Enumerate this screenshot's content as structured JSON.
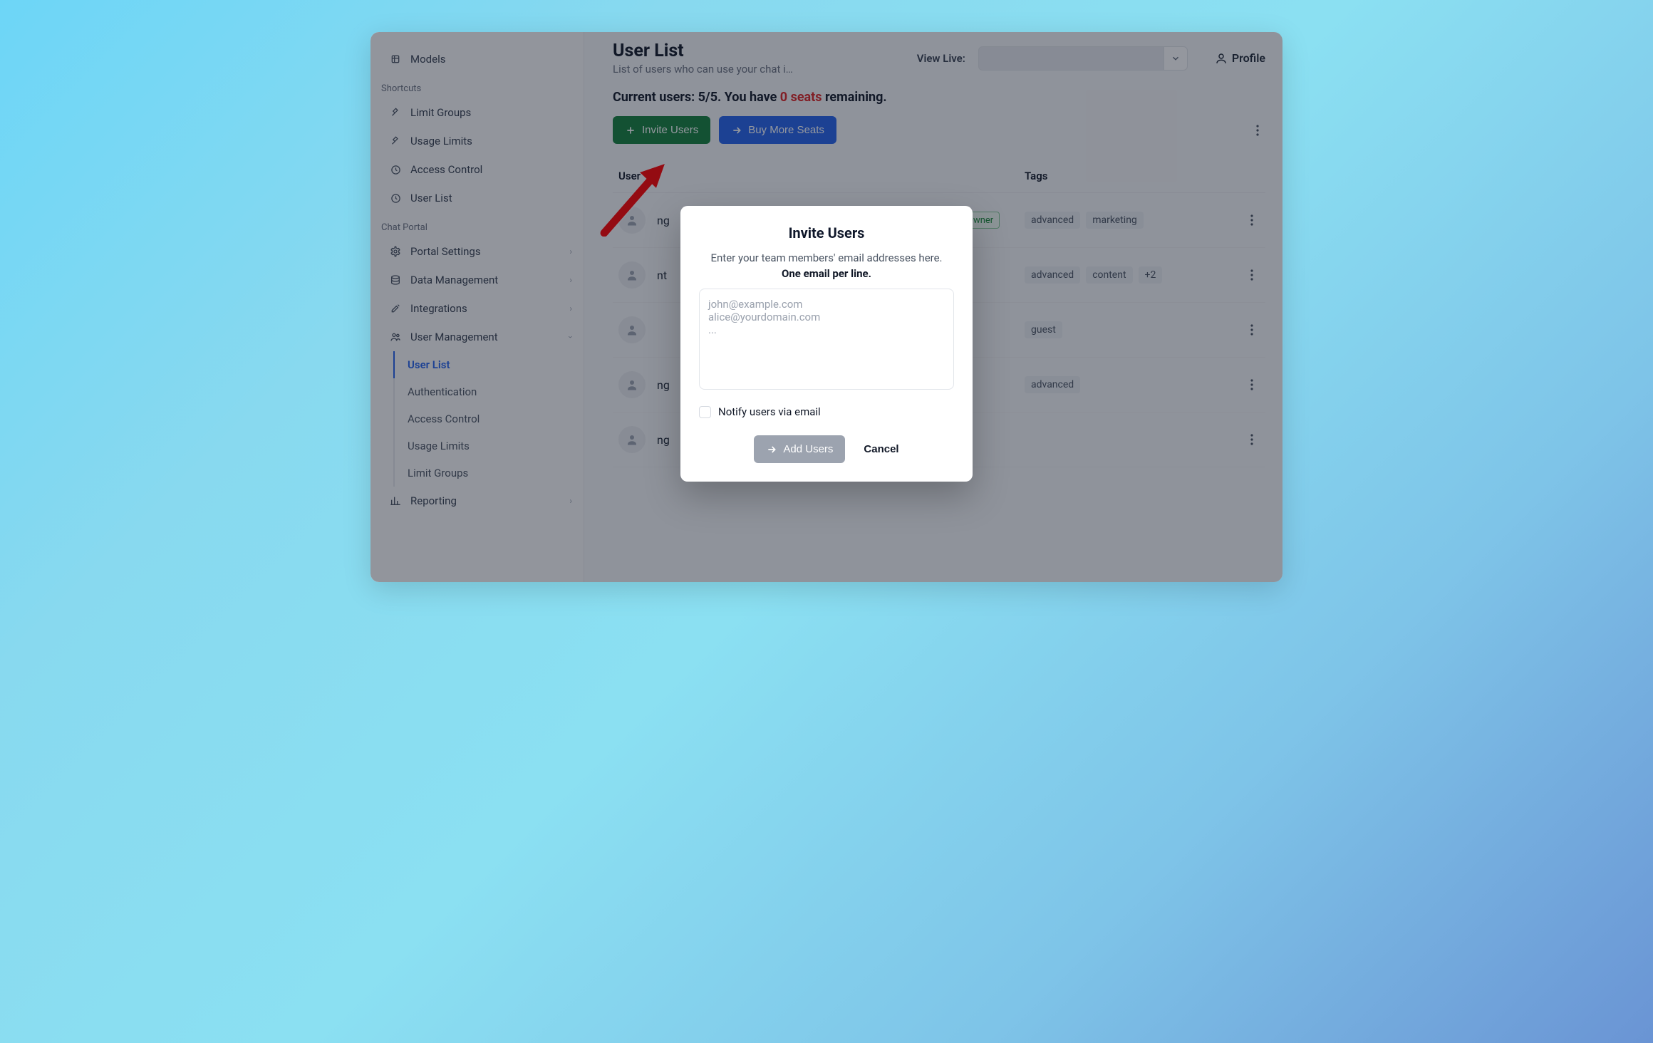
{
  "sidebar": {
    "top_item": {
      "label": "Models"
    },
    "shortcuts_heading": "Shortcuts",
    "shortcuts": [
      {
        "label": "Limit Groups"
      },
      {
        "label": "Usage Limits"
      },
      {
        "label": "Access Control"
      },
      {
        "label": "User List"
      }
    ],
    "portal_heading": "Chat Portal",
    "portal": [
      {
        "label": "Portal Settings",
        "expandable": true
      },
      {
        "label": "Data Management",
        "expandable": true
      },
      {
        "label": "Integrations",
        "expandable": true
      },
      {
        "label": "User Management",
        "expandable": true,
        "expanded": true
      }
    ],
    "user_mgmt_sub": [
      {
        "label": "User List",
        "active": true
      },
      {
        "label": "Authentication"
      },
      {
        "label": "Access Control"
      },
      {
        "label": "Usage Limits"
      },
      {
        "label": "Limit Groups"
      }
    ],
    "reporting": {
      "label": "Reporting",
      "expandable": true
    }
  },
  "header": {
    "title": "User List",
    "subtitle": "List of users who can use your chat i…",
    "view_live_label": "View Live:",
    "profile_label": "Profile"
  },
  "seats": {
    "prefix": "Current users: 5/5. You have ",
    "zero": "0 seats",
    "suffix": " remaining."
  },
  "actions": {
    "invite": "Invite Users",
    "buy": "Buy More Seats"
  },
  "table": {
    "headers": {
      "user": "User",
      "tags": "Tags"
    },
    "rows": [
      {
        "name": "ng",
        "role": "Owner",
        "tags": [
          "advanced",
          "marketing"
        ]
      },
      {
        "name": "nt",
        "role": "",
        "tags": [
          "advanced",
          "content",
          "+2"
        ]
      },
      {
        "name": "",
        "role": "",
        "tags": [
          "guest"
        ]
      },
      {
        "name": "ng",
        "role": "",
        "tags": [
          "advanced"
        ]
      },
      {
        "name": "ng",
        "role": "",
        "tags": []
      }
    ]
  },
  "modal": {
    "title": "Invite Users",
    "line1": "Enter your team members' email addresses here.",
    "line2": "One email per line.",
    "placeholder": "john@example.com\nalice@yourdomain.com\n...",
    "notify_label": "Notify users via email",
    "add_label": "Add Users",
    "cancel_label": "Cancel"
  }
}
